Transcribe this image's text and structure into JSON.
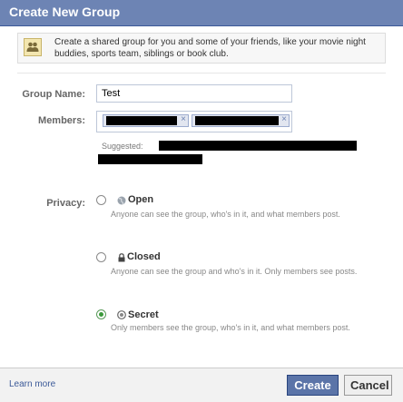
{
  "dialog": {
    "title": "Create New Group",
    "intro_text": "Create a shared group for you and some of your friends, like your movie night buddies, sports team, siblings or book club."
  },
  "form": {
    "group_name_label": "Group Name:",
    "group_name_value": "Test",
    "members_label": "Members:",
    "token_remove_glyph": "×",
    "suggested_label": "Suggested:"
  },
  "privacy": {
    "label": "Privacy:",
    "options": [
      {
        "title": "Open",
        "icon": "globe-icon",
        "description": "Anyone can see the group, who's in it, and what members post.",
        "checked": false
      },
      {
        "title": "Closed",
        "icon": "lock-icon",
        "description": "Anyone can see the group and who's in it. Only members see posts.",
        "checked": false
      },
      {
        "title": "Secret",
        "icon": "secret-icon",
        "description": "Only members see the group, who's in it, and what members post.",
        "checked": true
      }
    ]
  },
  "footer": {
    "learn_more": "Learn more",
    "create_label": "Create",
    "cancel_label": "Cancel"
  },
  "colors": {
    "title_bar": "#6d84b4",
    "primary_button": "#5b74a8",
    "link": "#3b5998"
  }
}
